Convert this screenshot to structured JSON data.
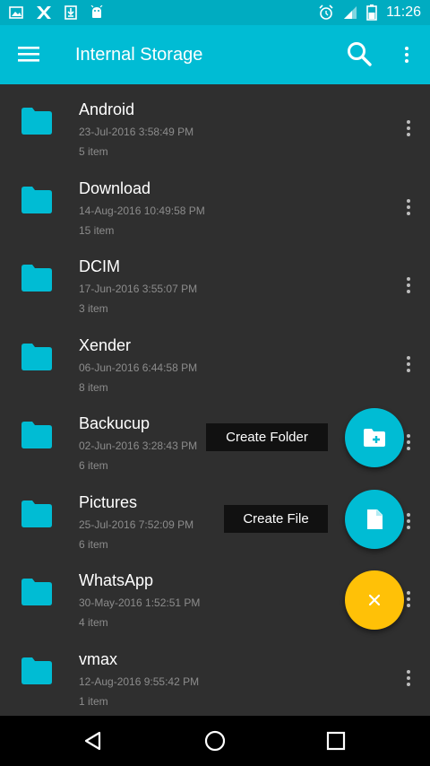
{
  "status_bar": {
    "time": "11:26",
    "left_icons": [
      "image-icon",
      "x-app-icon",
      "download-icon",
      "android-icon"
    ],
    "right_icons": [
      "alarm-icon",
      "signal-icon",
      "battery-icon"
    ]
  },
  "app_bar": {
    "title": "Internal Storage",
    "menu_icon": "hamburger-menu-icon",
    "search_icon": "search-icon",
    "overflow_icon": "more-vert-icon"
  },
  "folders": [
    {
      "name": "Android",
      "date": "23-Jul-2016 3:58:49 PM",
      "count": "5 item"
    },
    {
      "name": "Download",
      "date": "14-Aug-2016 10:49:58 PM",
      "count": "15 item"
    },
    {
      "name": "DCIM",
      "date": "17-Jun-2016 3:55:07 PM",
      "count": "3 item"
    },
    {
      "name": "Xender",
      "date": "06-Jun-2016 6:44:58 PM",
      "count": "8 item"
    },
    {
      "name": "Backucup",
      "date": "02-Jun-2016 3:28:43 PM",
      "count": "6 item"
    },
    {
      "name": "Pictures",
      "date": "25-Jul-2016 7:52:09 PM",
      "count": "6 item"
    },
    {
      "name": "WhatsApp",
      "date": "30-May-2016 1:52:51 PM",
      "count": "4 item"
    },
    {
      "name": "vmax",
      "date": "12-Aug-2016 9:55:42 PM",
      "count": "1 item"
    }
  ],
  "fab_menu": {
    "create_folder_label": "Create Folder",
    "create_file_label": "Create File",
    "close_icon": "close-icon"
  },
  "colors": {
    "primary": "#00bcd4",
    "status_bar": "#00acc1",
    "accent": "#ffc107",
    "background": "#2f2f2f",
    "secondary_text": "#8c8c8c"
  },
  "nav_bar": {
    "icons": [
      "back-icon",
      "home-icon",
      "recents-icon"
    ]
  }
}
